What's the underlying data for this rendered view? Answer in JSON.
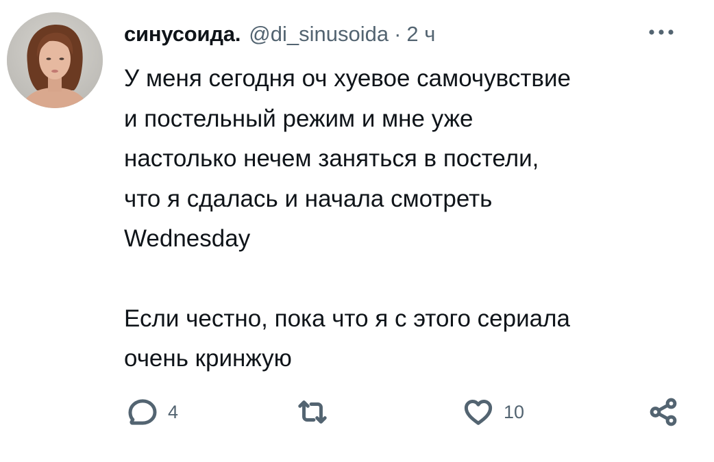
{
  "tweet": {
    "author_name": "синусоида.",
    "author_handle": "@di_sinusoida",
    "separator": "·",
    "time": "2 ч",
    "text_lines": [
      "У меня сегодня оч хуевое самочувствие",
      "и постельный режим и мне уже",
      "настолько нечем заняться в постели,",
      "что я сдалась и начала смотреть",
      "Wednesday"
    ],
    "text_lines_2": [
      "Если честно, пока что я с этого сериала",
      "очень кринжую"
    ]
  },
  "actions": {
    "reply_count": "4",
    "retweet_count": "",
    "like_count": "10"
  },
  "icons": {
    "more": "more-dots-icon",
    "reply": "reply-bubble-icon",
    "retweet": "retweet-icon",
    "like": "heart-icon",
    "share": "share-icon"
  },
  "colors": {
    "text": "#0f1419",
    "secondary": "#536471",
    "background": "#ffffff"
  }
}
